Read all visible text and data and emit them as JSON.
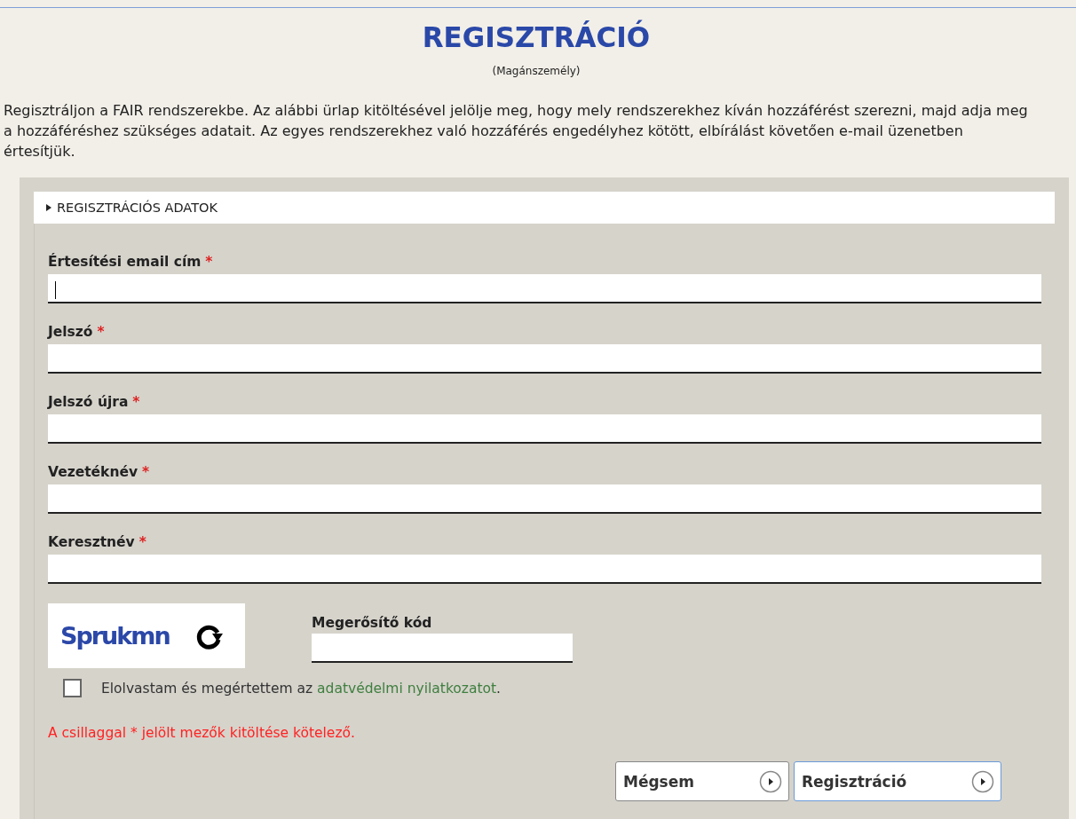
{
  "title": "REGISZTRÁCIÓ",
  "subtitle": "(Magánszemély)",
  "intro": "Regisztráljon a FAIR rendszerekbe. Az alábbi ürlap kitöltésével jelölje meg, hogy mely rendszerekhez kíván hozzáférést szerezni, majd adja meg a hozzáféréshez szükséges adatait. Az egyes rendszerekhez való hozzáférés engedélyhez kötött, elbírálást követően e-mail üzenetben értesítjük.",
  "section": {
    "label": "REGISZTRÁCIÓS ADATOK",
    "expanded": false
  },
  "required_mark": "*",
  "fields": [
    {
      "label": "Értesítési email cím",
      "required": true,
      "focused": true
    },
    {
      "label": "Jelszó",
      "required": true,
      "focused": false
    },
    {
      "label": "Jelszó újra",
      "required": true,
      "focused": false
    },
    {
      "label": "Vezetéknév",
      "required": true,
      "focused": false
    },
    {
      "label": "Keresztnév",
      "required": true,
      "focused": false
    }
  ],
  "captcha": {
    "code": "Sprukmn",
    "field_label": "Megerősítő kód"
  },
  "consent": {
    "checked": false,
    "text": "Elolvastam és megértettem az",
    "link": "adatvédelmi nyilatkozatot",
    "end": "."
  },
  "required_note": "A csillaggal * jelölt mezők kitöltése kötelező.",
  "buttons": [
    {
      "label": "Mégsem",
      "selected": false
    },
    {
      "label": "Regisztráció",
      "selected": true
    }
  ]
}
